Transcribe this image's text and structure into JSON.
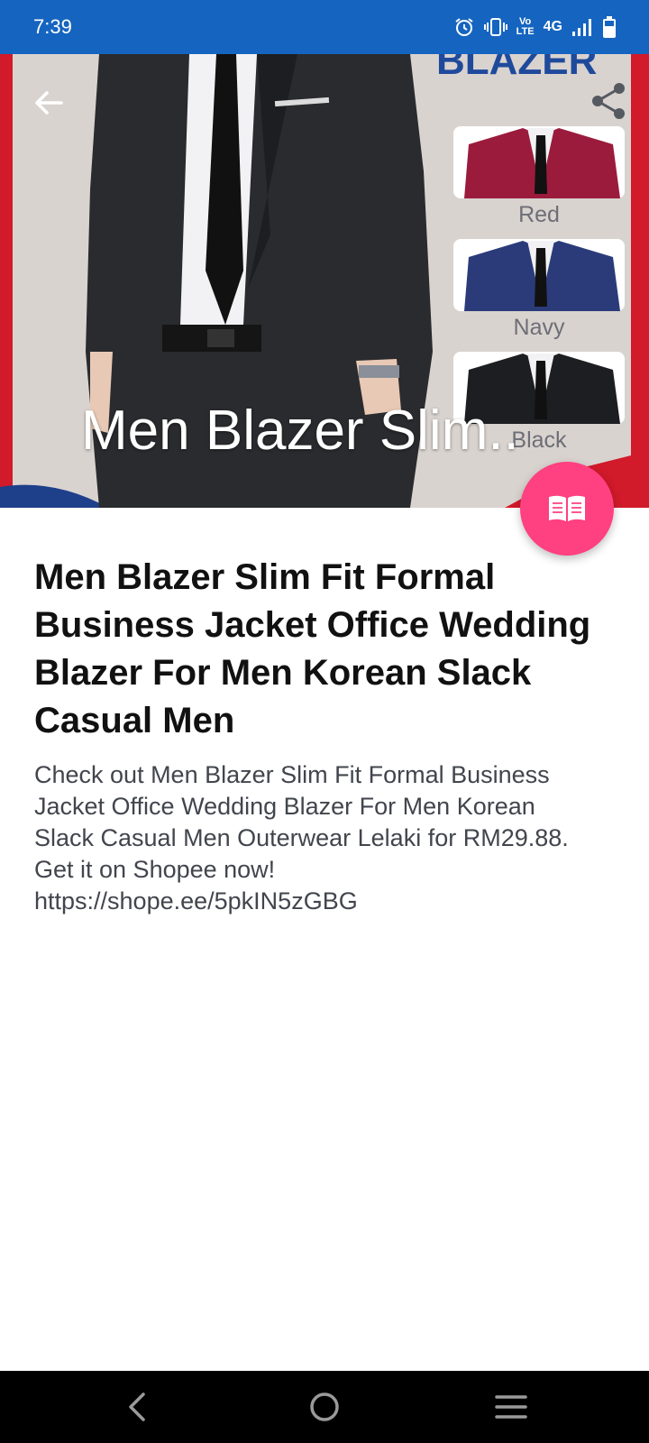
{
  "status_bar": {
    "time": "7:39",
    "network": "4G",
    "volte": "Vo LTE"
  },
  "hero": {
    "title": "Men Blazer Slim..",
    "image_text": {
      "banner": "BLAZER",
      "swatches": [
        "Red",
        "Navy",
        "Black"
      ]
    },
    "icons": {
      "back": "arrow-back-icon",
      "share": "share-icon",
      "fab": "book-open-icon"
    }
  },
  "product": {
    "title": "Men Blazer Slim Fit Formal Business Jacket Office Wedding Blazer For Men Korean Slack  Casual Men",
    "description": "Check out Men Blazer Slim Fit Formal Business Jacket Office Wedding Blazer For Men Korean Slack  Casual Men Outerwear Lelaki for RM29.88. Get it on Shopee now! https://shope.ee/5pkIN5zGBG"
  },
  "colors": {
    "status_bar": "#1565c0",
    "fab": "#ff4081",
    "title": "#111111",
    "description": "#42454d"
  }
}
